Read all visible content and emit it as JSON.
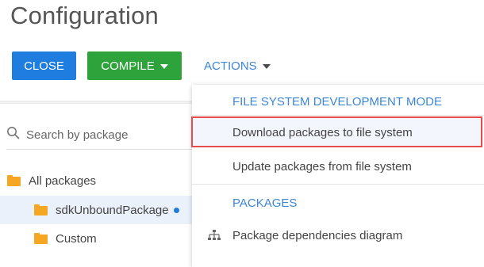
{
  "page": {
    "title": "Configuration"
  },
  "toolbar": {
    "close_label": "CLOSE",
    "compile_label": "COMPILE",
    "actions_label": "ACTIONS"
  },
  "search": {
    "placeholder": "Search by package",
    "value": ""
  },
  "tree": {
    "items": [
      {
        "label": "All packages"
      },
      {
        "label": "sdkUnboundPackage",
        "selected": true,
        "modified": true
      },
      {
        "label": "Custom"
      }
    ]
  },
  "actions_menu": {
    "header_file_system": "FILE SYSTEM DEVELOPMENT MODE",
    "download_label": "Download packages to file system",
    "update_label": "Update packages from file system",
    "header_packages": "PACKAGES",
    "dependencies_label": "Package dependencies diagram"
  },
  "colors": {
    "close_button": "#1f7de0",
    "compile_button": "#2ea33b",
    "link_blue": "#3c86d6",
    "highlight_border": "#e64c4c",
    "folder": "#f5a623"
  },
  "icons": [
    "search-icon",
    "folder-icon",
    "caret-down-icon",
    "hierarchy-icon"
  ]
}
